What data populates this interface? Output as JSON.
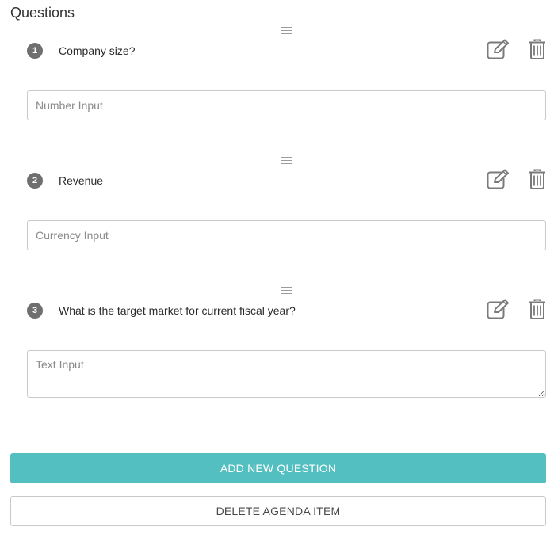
{
  "header": {
    "title": "Questions"
  },
  "questions": [
    {
      "number": "1",
      "label": "Company size?",
      "input_placeholder": "Number Input",
      "input_kind": "number"
    },
    {
      "number": "2",
      "label": "Revenue",
      "input_placeholder": "Currency Input",
      "input_kind": "currency"
    },
    {
      "number": "3",
      "label": "What is the target market for current fiscal year?",
      "input_placeholder": "Text Input",
      "input_kind": "text"
    }
  ],
  "icons": {
    "drag": "drag-handle-icon",
    "edit": "edit-icon",
    "delete": "trash-icon"
  },
  "actions": {
    "add_label": "ADD NEW QUESTION",
    "delete_label": "DELETE AGENDA ITEM"
  },
  "colors": {
    "primary": "#54bfc1",
    "badge": "#6f6f6f",
    "icon": "#7a7a7a",
    "border": "#c9c9c9"
  }
}
